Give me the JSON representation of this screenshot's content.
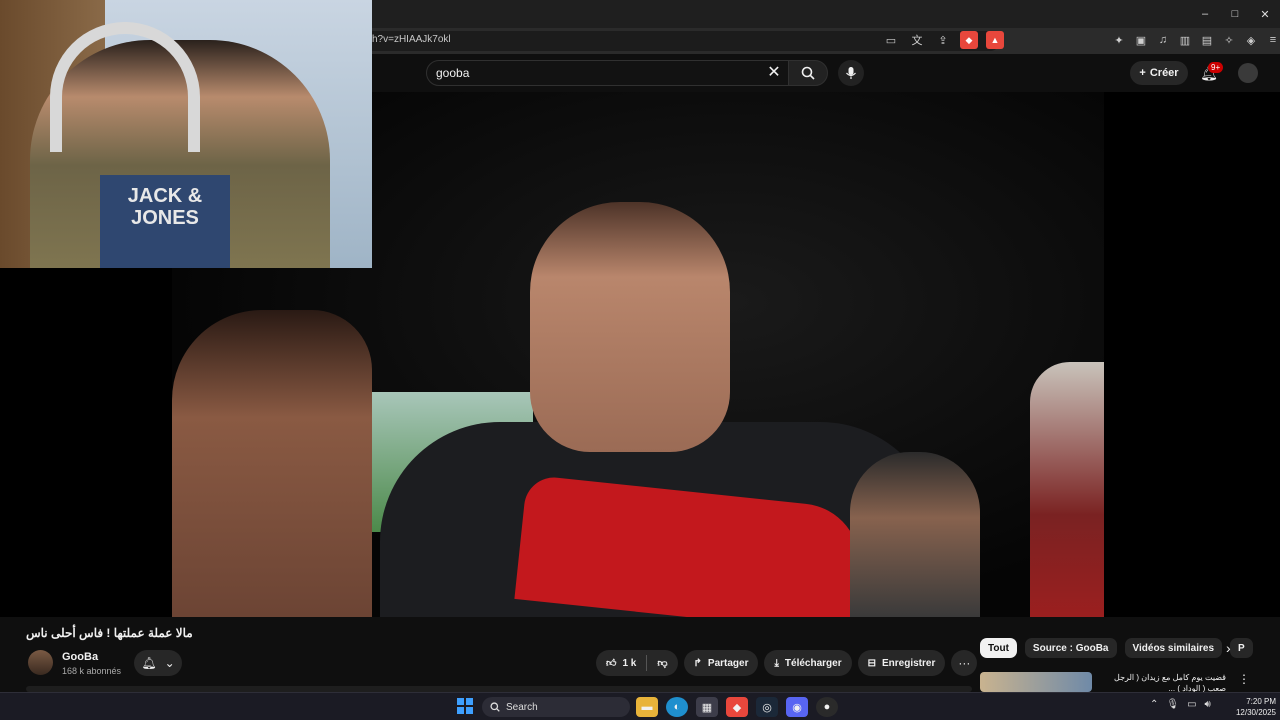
{
  "browser": {
    "url": "h?v=zHIAAJk7okl",
    "window_controls": [
      "–",
      "□",
      "✕"
    ],
    "addr_icons": [
      "cast-icon",
      "translate-icon",
      "share-icon",
      "brave-shield-icon",
      "brave-rewards-icon"
    ],
    "ext_icons": [
      "extensions-icon",
      "tab-icon",
      "music-icon",
      "sidebar-icon",
      "wallet-icon",
      "brave-ai-icon",
      "vpn-icon",
      "menu-icon"
    ]
  },
  "masthead": {
    "search_value": "gooba",
    "create_label": "Créer",
    "notif_badge": "9+"
  },
  "video": {
    "title": "مالا عملة عملتها ! فاس أحلى ناس",
    "webcam_shirt_text": "JACK & JONES"
  },
  "channel": {
    "name": "GooBa",
    "subscribers": "168 k abonnés"
  },
  "actions": {
    "likes": "1 k",
    "share": "Partager",
    "download": "Télécharger",
    "save": "Enregistrer",
    "more": "···"
  },
  "chips": {
    "all": "Tout",
    "source": "Source : GooBa",
    "similar": "Vidéos similaires",
    "partial": "P",
    "next": "›"
  },
  "recommendation": {
    "title": "قضيت يوم كامل مع زيدان ( الرجل صعب ( الوداد ) ...",
    "menu": "⋮"
  },
  "taskbar": {
    "search_label": "Search",
    "time": "7:20 PM",
    "date": "12/30/2025"
  },
  "colors": {
    "accent": "#cc0000",
    "background": "#0f0f0f",
    "chip": "#272727"
  }
}
